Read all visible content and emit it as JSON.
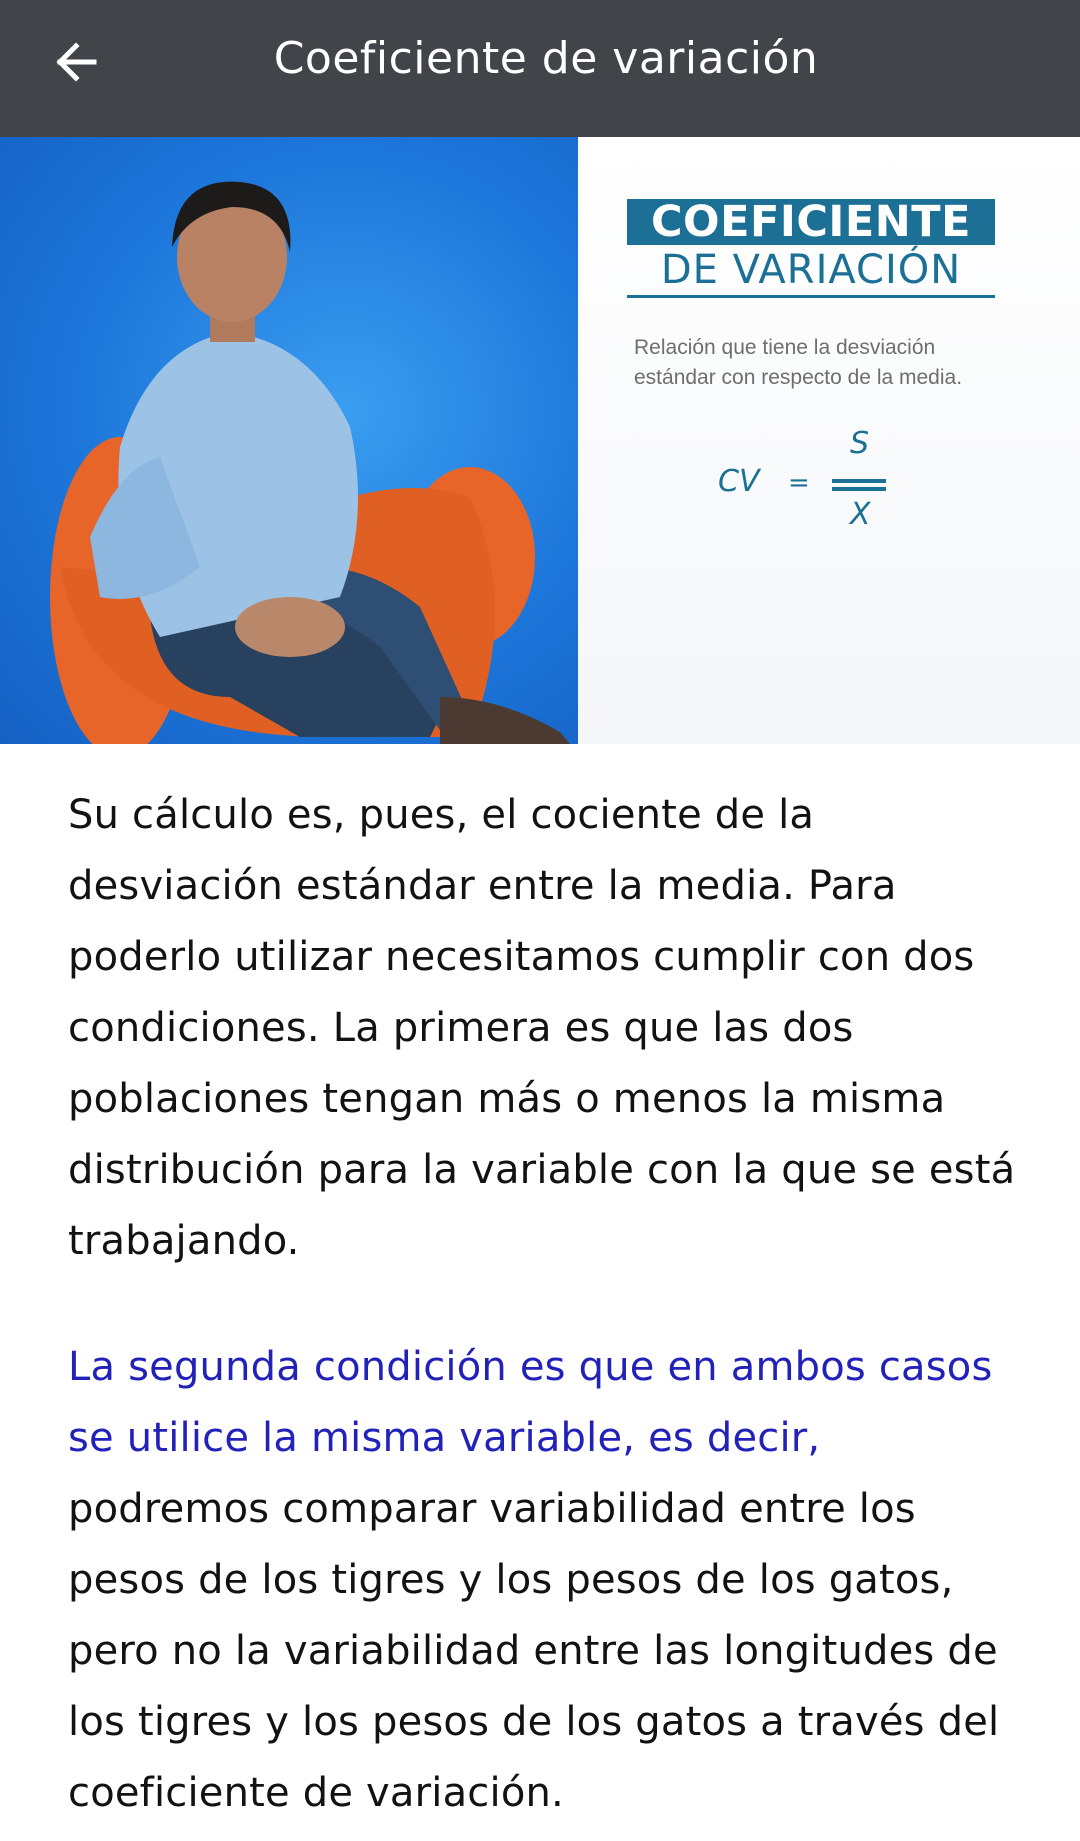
{
  "app_bar": {
    "title": "Coeficiente de variación",
    "back_icon": "arrow-left-icon"
  },
  "video": {
    "slide_title_line1": "COEFICIENTE",
    "slide_title_line2": "DE VARIACIÓN",
    "slide_description": "Relación que tiene la desviación estándar con respecto de la media.",
    "formula": {
      "lhs": "CV",
      "equals": "=",
      "numerator": "S",
      "denominator": "X"
    },
    "colors": {
      "slide_accent": "#1c6f95",
      "backdrop_blue": "#1d76da",
      "chair_orange": "#e8652a"
    }
  },
  "content": {
    "paragraph1": "Su cálculo es, pues, el cociente de la desviación estándar entre la media. Para poderlo utilizar necesitamos cumplir con dos condiciones. La primera es que las dos poblaciones tengan más o menos la misma distribución para la variable con la que se está trabajando.",
    "paragraph2_highlight": "La segunda condición es que en ambos casos se utilice la misma variable, es decir,",
    "paragraph2_rest": " podremos comparar variabilidad entre los pesos de los tigres y los pesos de los gatos, pero no la variabilidad entre las longitudes de los tigres y los pesos de los gatos a través del coeficiente de variación.",
    "colors": {
      "text": "#121212",
      "highlight": "#2222bb"
    }
  },
  "theme": {
    "app_bar_bg": "#414549",
    "background": "#ffffff"
  }
}
